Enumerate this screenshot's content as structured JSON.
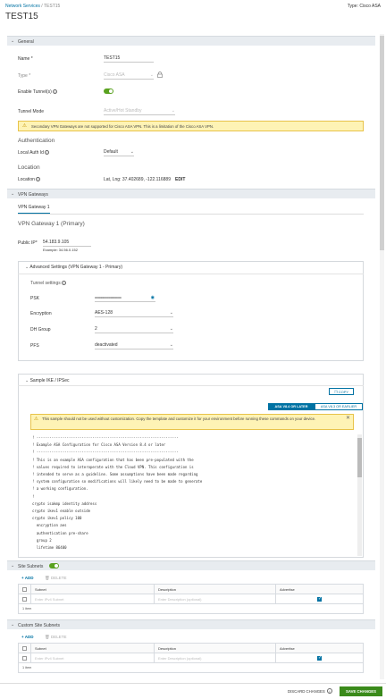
{
  "header": {
    "breadcrumb_root": "Network Services",
    "breadcrumb_sep": " / ",
    "breadcrumb_current": "TEST15",
    "type_label": "Type: Cisco ASA",
    "title": "TEST15"
  },
  "general": {
    "section_label": "General",
    "name_label": "Name *",
    "name_value": "TEST15",
    "type_label": "Type *",
    "type_value": "Cisco ASA",
    "tunnels_label": "Enable Tunnel(s)",
    "tunnel_mode_label": "Tunnel Mode",
    "tunnel_mode_value": "Active/Hot Standby",
    "warning": "Secondary VPN Gateways are not supported for Cisco ASA VPN. This is a limitation of the Cisco ASA VPN.",
    "auth_heading": "Authentication",
    "local_auth_label": "Local Auth Id",
    "local_auth_value": "Default",
    "location_heading": "Location",
    "location_label": "Location",
    "location_value": "Lat, Lng: 37.402689, -122.116889",
    "edit_link": "EDIT"
  },
  "vpn": {
    "section_label": "VPN Gateways",
    "tab_label": "VPN Gateway 1",
    "gateway_heading": "VPN Gateway 1 (Primary)",
    "public_ip_label": "Public IP*",
    "public_ip_value": "54.183.9.105",
    "public_ip_example": "Example: 34.56.0.152",
    "advanced_label": "Advanced Settings (VPN Gateway 1 - Primary)",
    "tunnel_settings_label": "Tunnel settings",
    "psk_label": "PSK",
    "psk_value": "••••••••••••••••••••••••••••••••",
    "encryption_label": "Encryption",
    "encryption_value": "AES-128",
    "dh_label": "DH Group",
    "dh_value": "2",
    "pfs_label": "PFS",
    "pfs_value": "deactivated"
  },
  "sample": {
    "label": "Sample IKE / IPSec",
    "copy_label": "COPY",
    "seg_left": "ASA V8.4 OR LATER",
    "seg_right": "ASA V8.3 OR EARLIER",
    "warning": "This sample should not be used without customization. Copy the template and customize it for your environment before running these commands on your device.",
    "code": "! ------------------------------------------------------------------\n! Example ASA Configuration for Cisco ASA Version 8.4 or later\n! ------------------------------------------------------------------\n! This is an example ASA configuration that has been pre-populated with the\n! values required to interoperate with the Cloud VPN. This configuration is\n! intended to serve as a guideline. Some assumptions have been made regarding\n! system configuration so modifications will likely need to be made to generate\n! a working configuration.\n!\ncrypto isakmp identity address\ncrypto ikev1 enable outside\ncrypto ikev1 policy 100\n  encryption aes\n  authentication pre-share\n  group 2\n  lifetime 86400"
  },
  "site_subnets": {
    "label": "Site Subnets",
    "add_label": "+ ADD",
    "delete_label": "DELETE",
    "col_subnet": "Subnet",
    "col_description": "Description",
    "col_advertise": "Advertise",
    "subnet_placeholder": "Enter IPv4 Subnet",
    "desc_placeholder": "Enter Description (optional)",
    "count": "1 item"
  },
  "custom_subnets": {
    "label": "Custom Site Subnets",
    "add_label": "+ ADD",
    "delete_label": "DELETE",
    "col_subnet": "Subnet",
    "col_description": "Description",
    "col_advertise": "Advertise",
    "subnet_placeholder": "Enter IPv4 Subnet",
    "desc_placeholder": "Enter Description (optional)",
    "count": "1 item"
  },
  "footer": {
    "discard": "DISCARD CHANGES",
    "save": "SAVE CHANGES"
  },
  "colors": {
    "accent": "#0072a3",
    "toggle_on": "#5aa220",
    "save_button": "#3a8a1a",
    "warning_bg": "#fef3b5"
  }
}
